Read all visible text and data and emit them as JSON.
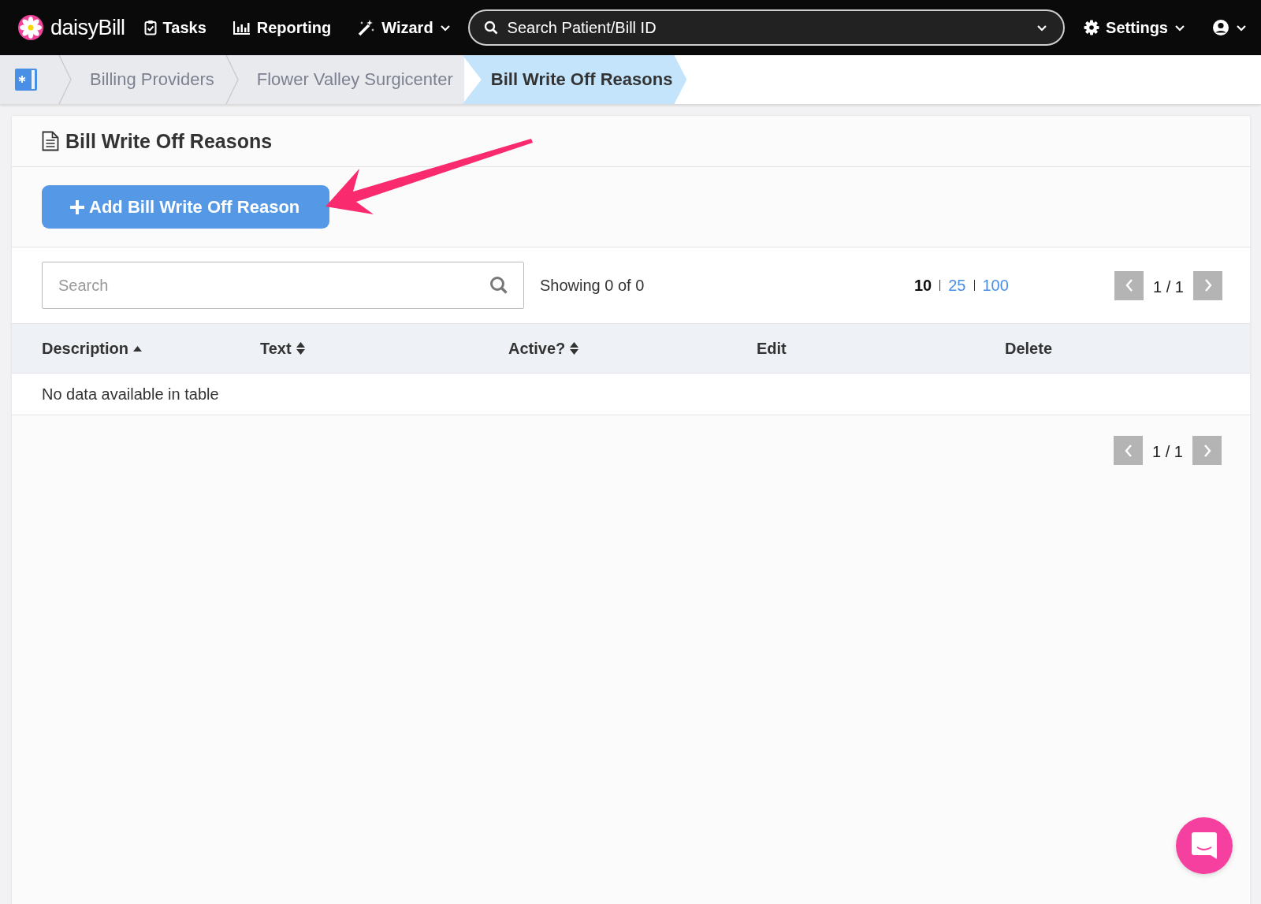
{
  "navbar": {
    "brand": "daisyBill",
    "items": [
      {
        "label": "Tasks",
        "kind": "tasks",
        "dropdown": false
      },
      {
        "label": "Reporting",
        "kind": "reporting",
        "dropdown": false
      },
      {
        "label": "Wizard",
        "kind": "wizard",
        "dropdown": true
      }
    ],
    "search": {
      "placeholder": "Search Patient/Bill ID"
    },
    "settings": {
      "label": "Settings",
      "dropdown": true
    }
  },
  "breadcrumb": [
    {
      "label": "Billing Providers",
      "selected": false
    },
    {
      "label": "Flower Valley Surgicenter",
      "selected": false
    },
    {
      "label": "Bill Write Off Reasons",
      "selected": true
    }
  ],
  "panel": {
    "title": "Bill Write Off Reasons",
    "add_button": "Add Bill Write Off Reason",
    "search": {
      "placeholder": "Search"
    },
    "showing": "Showing 0 of 0",
    "page_sizes": [
      {
        "label": "10",
        "selected": true
      },
      {
        "label": "25",
        "selected": false
      },
      {
        "label": "100",
        "selected": false
      }
    ],
    "pagers": [
      {
        "page": "1 / 1"
      },
      {
        "page": "1 / 1"
      }
    ],
    "table": {
      "columns": [
        {
          "label": "Description",
          "sortable": true,
          "sorted": true
        },
        {
          "label": "Text",
          "sortable": true,
          "sorted": false
        },
        {
          "label": "Active?",
          "sortable": true,
          "sorted": false
        },
        {
          "label": "Edit",
          "sortable": false,
          "sorted": false
        },
        {
          "label": "Delete",
          "sortable": false,
          "sorted": false
        }
      ],
      "empty_message": "No data available in table"
    }
  }
}
